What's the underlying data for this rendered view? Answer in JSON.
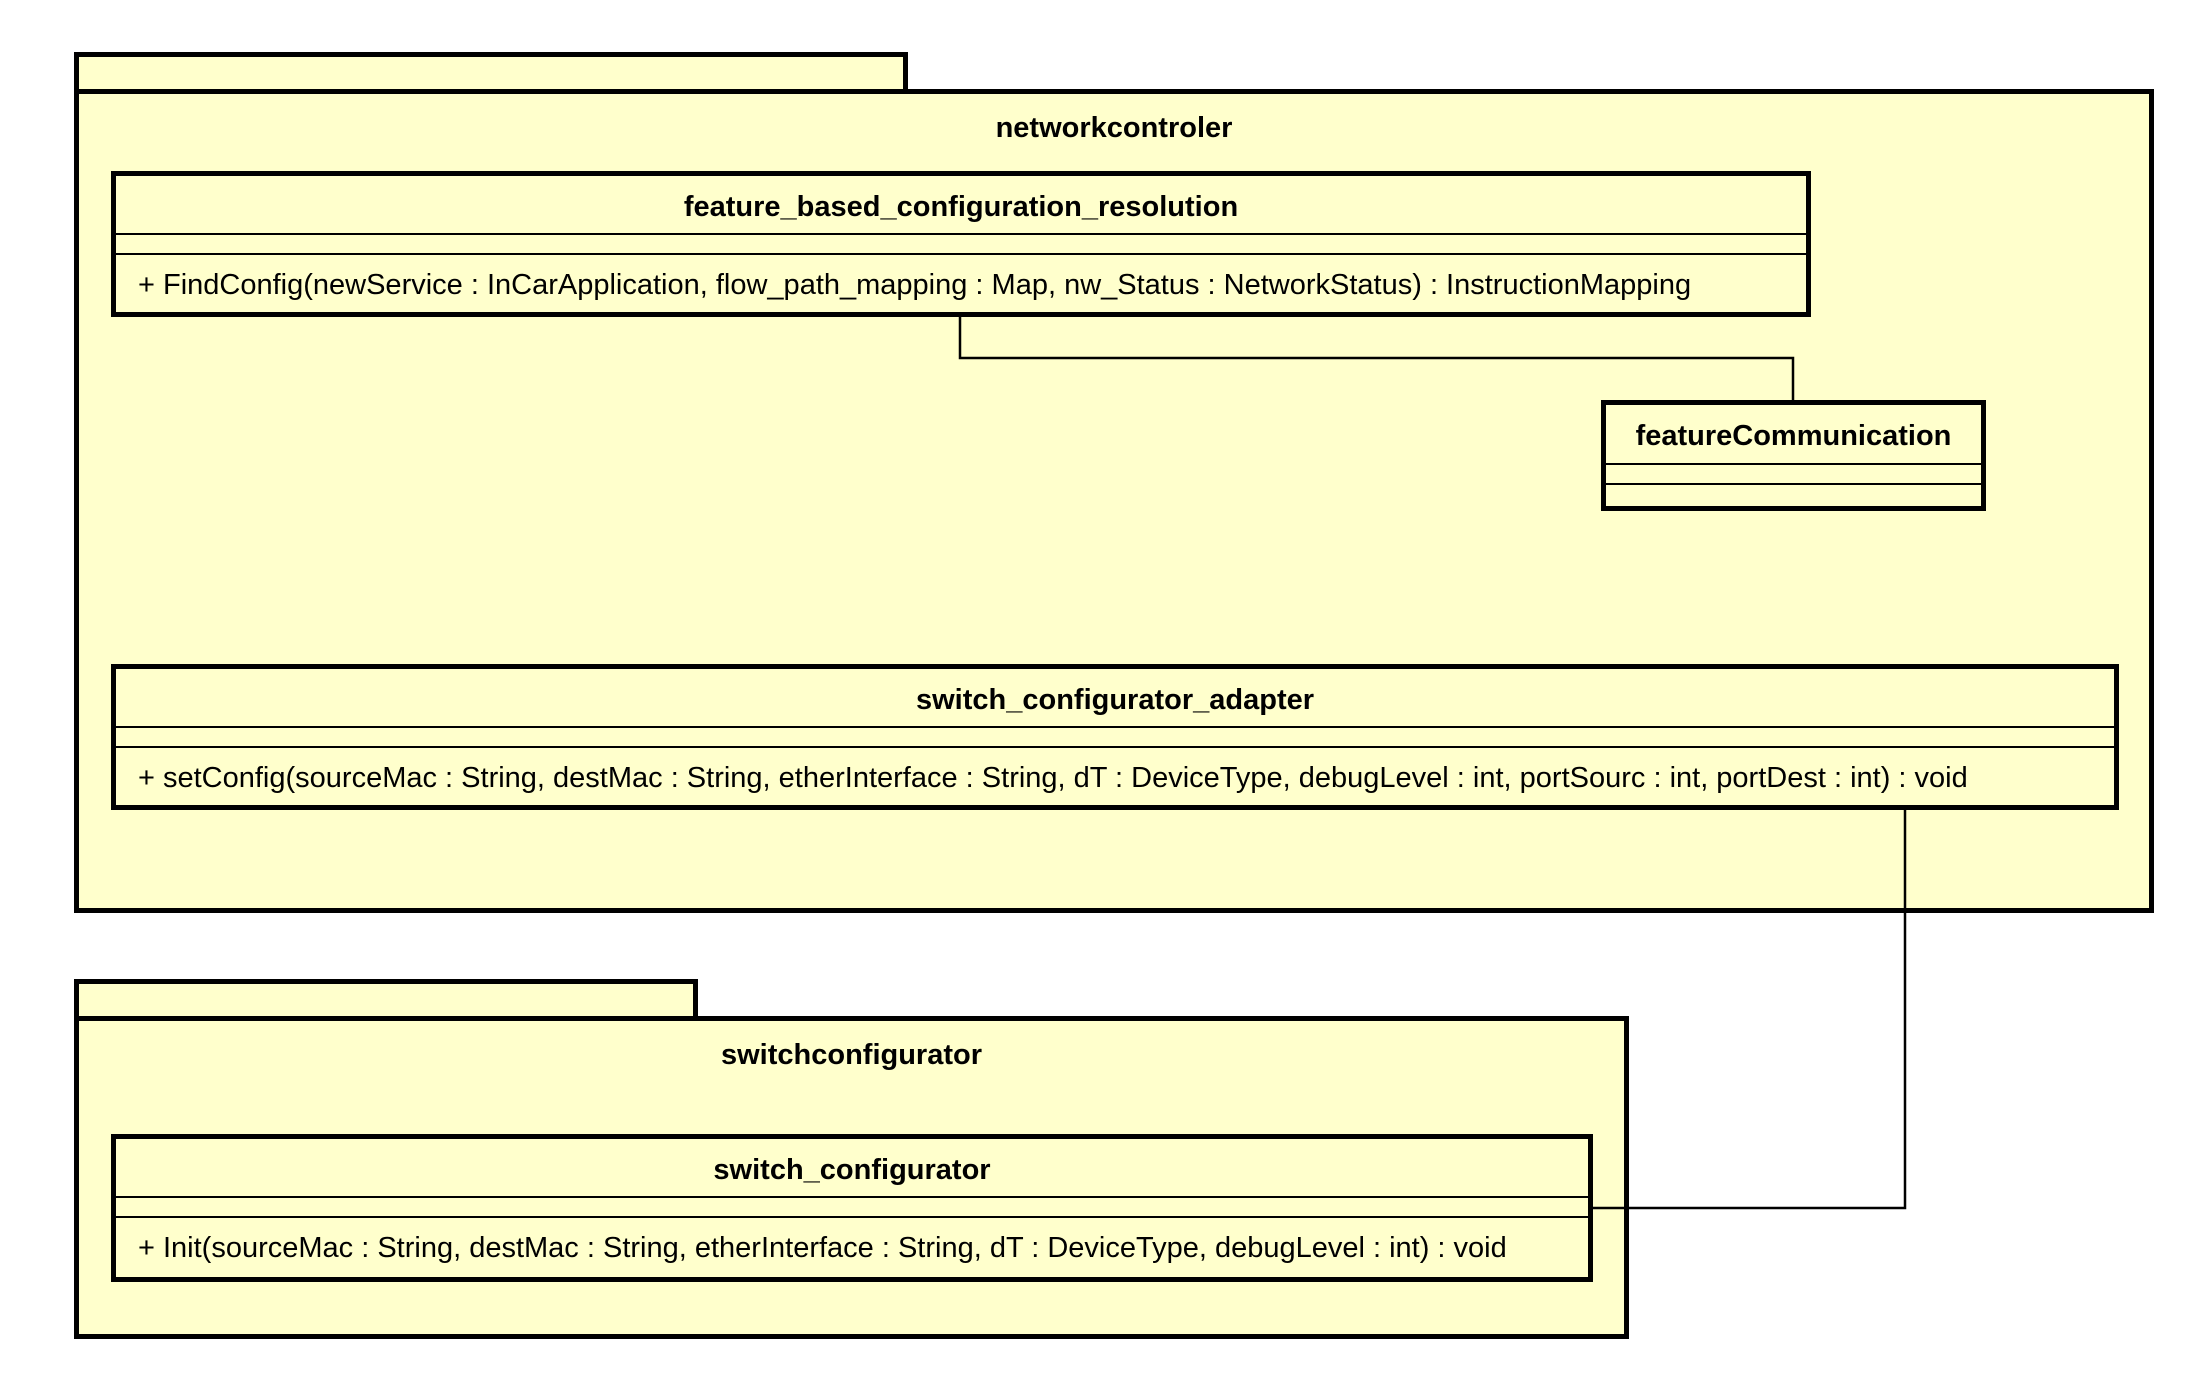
{
  "diagram": {
    "packages": [
      {
        "name": "networkcontroler",
        "classes": [
          {
            "name": "feature_based_configuration_resolution",
            "operations": [
              "+ FindConfig(newService : InCarApplication, flow_path_mapping : Map, nw_Status : NetworkStatus) : InstructionMapping"
            ]
          },
          {
            "name": "featureCommunication",
            "operations": []
          },
          {
            "name": "switch_configurator_adapter",
            "operations": [
              "+ setConfig(sourceMac : String, destMac : String, etherInterface : String, dT : DeviceType, debugLevel : int, portSourc : int, portDest : int) : void"
            ]
          }
        ]
      },
      {
        "name": "switchconfigurator",
        "classes": [
          {
            "name": "switch_configurator",
            "operations": [
              "+ Init(sourceMac : String, destMac : String, etherInterface : String, dT : DeviceType, debugLevel : int) : void"
            ]
          }
        ]
      }
    ],
    "associations": [
      {
        "from": "feature_based_configuration_resolution",
        "to": "featureCommunication"
      },
      {
        "from": "switch_configurator_adapter",
        "to": "switch_configurator"
      }
    ],
    "colors": {
      "fill": "#ffffcc",
      "stroke": "#000000"
    }
  }
}
